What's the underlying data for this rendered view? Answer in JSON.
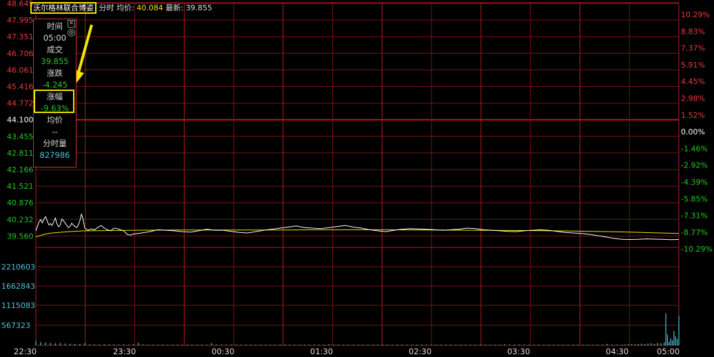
{
  "header": {
    "stock_name": "沃尔格林联合博姿",
    "mode_label": "分时",
    "avg_label": "均价:",
    "avg_value": "40.084",
    "last_label": "最新:",
    "last_value": "39.855"
  },
  "info_panel": {
    "time_label": "时间",
    "time_value": "05:00",
    "vol_label": "成交",
    "vol_value": "39.855",
    "change_label": "涨跌",
    "change_value": "-4.245",
    "pct_label": "涨幅",
    "pct_value": "-9.63%",
    "avg_label": "均价",
    "avg_value": "--",
    "minvol_label": "分时量",
    "minvol_value": "827986",
    "close_icon": "close-icon",
    "settings_icon": "gear-icon"
  },
  "colors": {
    "up": "#e83c3c",
    "down": "#22c81e",
    "neutral": "#ffffff",
    "grid": "#7a1414",
    "price_line": "#ffffff",
    "avg_line": "#f2e600",
    "volume": "#49c8d8",
    "highlight": "#f2e600"
  },
  "chart_data": {
    "type": "line",
    "prev_close": 44.1,
    "price_ticks": [
      "48.645",
      "47.995",
      "47.351",
      "46.706",
      "46.061",
      "45.416",
      "44.772",
      "44.100",
      "43.455",
      "42.811",
      "42.166",
      "41.521",
      "40.876",
      "40.232",
      "39.560"
    ],
    "pct_ticks": [
      "10.29%",
      "8.83%",
      "7.37%",
      "5.91%",
      "4.45%",
      "2.98%",
      "1.52%",
      "0.00%",
      "-1.46%",
      "-2.92%",
      "-4.39%",
      "-5.85%",
      "-7.31%",
      "-8.77%",
      "-10.29%"
    ],
    "volume_ticks": [
      "2210603",
      "1662843",
      "1115083",
      "567323"
    ],
    "time_ticks": [
      "22:30",
      "23:30",
      "00:30",
      "01:30",
      "02:30",
      "03:30",
      "04:30",
      "05:00"
    ],
    "ylim": [
      39.56,
      48.645
    ],
    "volume_max": 2758363,
    "grid": true,
    "series": [
      {
        "name": "最新",
        "x": [
          0,
          1,
          2,
          3,
          4,
          5,
          6,
          7,
          8,
          9,
          10,
          11,
          12,
          13,
          14,
          15,
          16,
          17,
          18,
          19,
          20,
          21,
          22,
          23,
          24,
          25,
          26,
          27,
          28,
          29,
          30,
          32,
          34,
          36,
          38,
          40,
          42,
          44,
          46,
          48,
          50,
          52,
          54,
          56,
          58,
          60,
          65,
          70,
          75,
          80,
          85,
          90,
          95,
          100,
          105,
          110,
          115,
          120,
          125,
          130,
          135,
          140,
          145,
          150,
          155,
          160,
          165,
          170,
          175,
          180,
          185,
          190,
          195,
          200,
          205,
          210,
          215,
          220,
          225,
          230,
          235,
          240,
          245,
          250,
          255,
          260,
          265,
          270,
          275,
          280,
          285,
          290,
          295,
          300,
          305,
          310,
          315,
          320,
          325,
          330,
          335,
          340,
          345,
          350,
          355,
          360,
          365,
          370,
          375,
          380,
          385,
          390,
          395
        ],
        "values": [
          40.18,
          40.35,
          40.52,
          40.6,
          40.48,
          40.62,
          40.71,
          40.55,
          40.4,
          40.45,
          40.38,
          40.52,
          40.66,
          40.44,
          40.33,
          40.4,
          40.62,
          40.55,
          40.47,
          40.38,
          40.3,
          40.34,
          40.46,
          40.4,
          40.35,
          40.3,
          40.38,
          40.55,
          40.8,
          40.62,
          40.28,
          40.2,
          40.25,
          40.22,
          40.3,
          40.38,
          40.28,
          40.22,
          40.18,
          40.28,
          40.26,
          40.22,
          40.18,
          40.05,
          40.02,
          40.06,
          40.1,
          40.15,
          40.22,
          40.2,
          40.18,
          40.15,
          40.13,
          40.18,
          40.24,
          40.2,
          40.2,
          40.16,
          40.12,
          40.1,
          40.15,
          40.2,
          40.24,
          40.28,
          40.32,
          40.36,
          40.3,
          40.28,
          40.26,
          40.3,
          40.34,
          40.38,
          40.32,
          40.28,
          40.22,
          40.18,
          40.15,
          40.2,
          40.24,
          40.26,
          40.25,
          40.24,
          40.22,
          40.2,
          40.22,
          40.24,
          40.28,
          40.26,
          40.22,
          40.2,
          40.18,
          40.16,
          40.15,
          40.18,
          40.2,
          40.22,
          40.2,
          40.16,
          40.12,
          40.1,
          40.08,
          40.05,
          40.0,
          39.95,
          39.9,
          39.86,
          39.855,
          39.86,
          39.88,
          39.87,
          39.86,
          39.85,
          39.855
        ]
      },
      {
        "name": "均价",
        "x": [
          0,
          5,
          10,
          20,
          30,
          45,
          60,
          90,
          120,
          150,
          180,
          210,
          240,
          270,
          300,
          330,
          360,
          395
        ],
        "values": [
          39.95,
          40.05,
          40.1,
          40.15,
          40.18,
          40.19,
          40.2,
          40.21,
          40.21,
          40.21,
          40.22,
          40.22,
          40.21,
          40.2,
          40.19,
          40.17,
          40.14,
          40.08
        ]
      }
    ],
    "volume": [
      [
        0,
        120000
      ],
      [
        3,
        90000
      ],
      [
        6,
        80000
      ],
      [
        9,
        70000
      ],
      [
        12,
        60000
      ],
      [
        15,
        65000
      ],
      [
        18,
        50000
      ],
      [
        21,
        45000
      ],
      [
        24,
        40000
      ],
      [
        27,
        35000
      ],
      [
        30,
        55000
      ],
      [
        33,
        30000
      ],
      [
        36,
        28000
      ],
      [
        39,
        26000
      ],
      [
        42,
        35000
      ],
      [
        45,
        25000
      ],
      [
        48,
        22000
      ],
      [
        51,
        20000
      ],
      [
        54,
        24000
      ],
      [
        57,
        18000
      ],
      [
        60,
        30000
      ],
      [
        63,
        70000
      ],
      [
        66,
        22000
      ],
      [
        69,
        18000
      ],
      [
        72,
        16000
      ],
      [
        75,
        20000
      ],
      [
        78,
        15000
      ],
      [
        81,
        14000
      ],
      [
        84,
        18000
      ],
      [
        87,
        12000
      ],
      [
        90,
        13000
      ],
      [
        93,
        11000
      ],
      [
        96,
        15000
      ],
      [
        99,
        10000
      ],
      [
        102,
        12000
      ],
      [
        105,
        14000
      ],
      [
        108,
        60000
      ],
      [
        111,
        11000
      ],
      [
        114,
        9000
      ],
      [
        117,
        10000
      ],
      [
        120,
        12000
      ],
      [
        123,
        9000
      ],
      [
        126,
        11000
      ],
      [
        129,
        8000
      ],
      [
        132,
        10000
      ],
      [
        135,
        9000
      ],
      [
        138,
        12000
      ],
      [
        141,
        8000
      ],
      [
        144,
        9000
      ],
      [
        147,
        7000
      ],
      [
        150,
        15000
      ],
      [
        153,
        9000
      ],
      [
        156,
        8000
      ],
      [
        159,
        9000
      ],
      [
        162,
        7000
      ],
      [
        165,
        8000
      ],
      [
        168,
        10000
      ],
      [
        171,
        7000
      ],
      [
        174,
        9000
      ],
      [
        177,
        8000
      ],
      [
        180,
        30000
      ],
      [
        183,
        9000
      ],
      [
        186,
        8000
      ],
      [
        189,
        10000
      ],
      [
        192,
        7000
      ],
      [
        195,
        8000
      ],
      [
        198,
        9000
      ],
      [
        201,
        7000
      ],
      [
        204,
        8000
      ],
      [
        207,
        6000
      ],
      [
        210,
        9000
      ],
      [
        213,
        7000
      ],
      [
        216,
        6000
      ],
      [
        219,
        8000
      ],
      [
        222,
        7000
      ],
      [
        225,
        9000
      ],
      [
        228,
        6000
      ],
      [
        231,
        8000
      ],
      [
        234,
        7000
      ],
      [
        237,
        6000
      ],
      [
        240,
        10000
      ],
      [
        243,
        8000
      ],
      [
        246,
        7000
      ],
      [
        249,
        9000
      ],
      [
        252,
        6000
      ],
      [
        255,
        8000
      ],
      [
        258,
        7000
      ],
      [
        261,
        9000
      ],
      [
        264,
        6000
      ],
      [
        267,
        8000
      ],
      [
        270,
        7000
      ],
      [
        273,
        9000
      ],
      [
        276,
        6000
      ],
      [
        279,
        8000
      ],
      [
        282,
        7000
      ],
      [
        285,
        9000
      ],
      [
        288,
        30000
      ],
      [
        291,
        7000
      ],
      [
        294,
        8000
      ],
      [
        297,
        6000
      ],
      [
        300,
        9000
      ],
      [
        303,
        7000
      ],
      [
        306,
        8000
      ],
      [
        309,
        6000
      ],
      [
        312,
        9000
      ],
      [
        315,
        7000
      ],
      [
        318,
        8000
      ],
      [
        321,
        6000
      ],
      [
        324,
        9000
      ],
      [
        327,
        7000
      ],
      [
        330,
        10000
      ],
      [
        333,
        12000
      ],
      [
        336,
        9000
      ],
      [
        339,
        11000
      ],
      [
        342,
        10000
      ],
      [
        345,
        12000
      ],
      [
        348,
        15000
      ],
      [
        351,
        40000
      ],
      [
        354,
        12000
      ],
      [
        357,
        18000
      ],
      [
        360,
        20000
      ],
      [
        362,
        25000
      ],
      [
        364,
        30000
      ],
      [
        366,
        35000
      ],
      [
        368,
        28000
      ],
      [
        370,
        40000
      ],
      [
        372,
        45000
      ],
      [
        374,
        35000
      ],
      [
        376,
        50000
      ],
      [
        378,
        60000
      ],
      [
        380,
        40000
      ],
      [
        382,
        70000
      ],
      [
        384,
        55000
      ],
      [
        386,
        80000
      ],
      [
        387,
        900000
      ],
      [
        388,
        300000
      ],
      [
        389,
        100000
      ],
      [
        390,
        200000
      ],
      [
        391,
        140000
      ],
      [
        392,
        400000
      ],
      [
        393,
        250000
      ],
      [
        394,
        180000
      ],
      [
        395,
        827986
      ]
    ]
  }
}
